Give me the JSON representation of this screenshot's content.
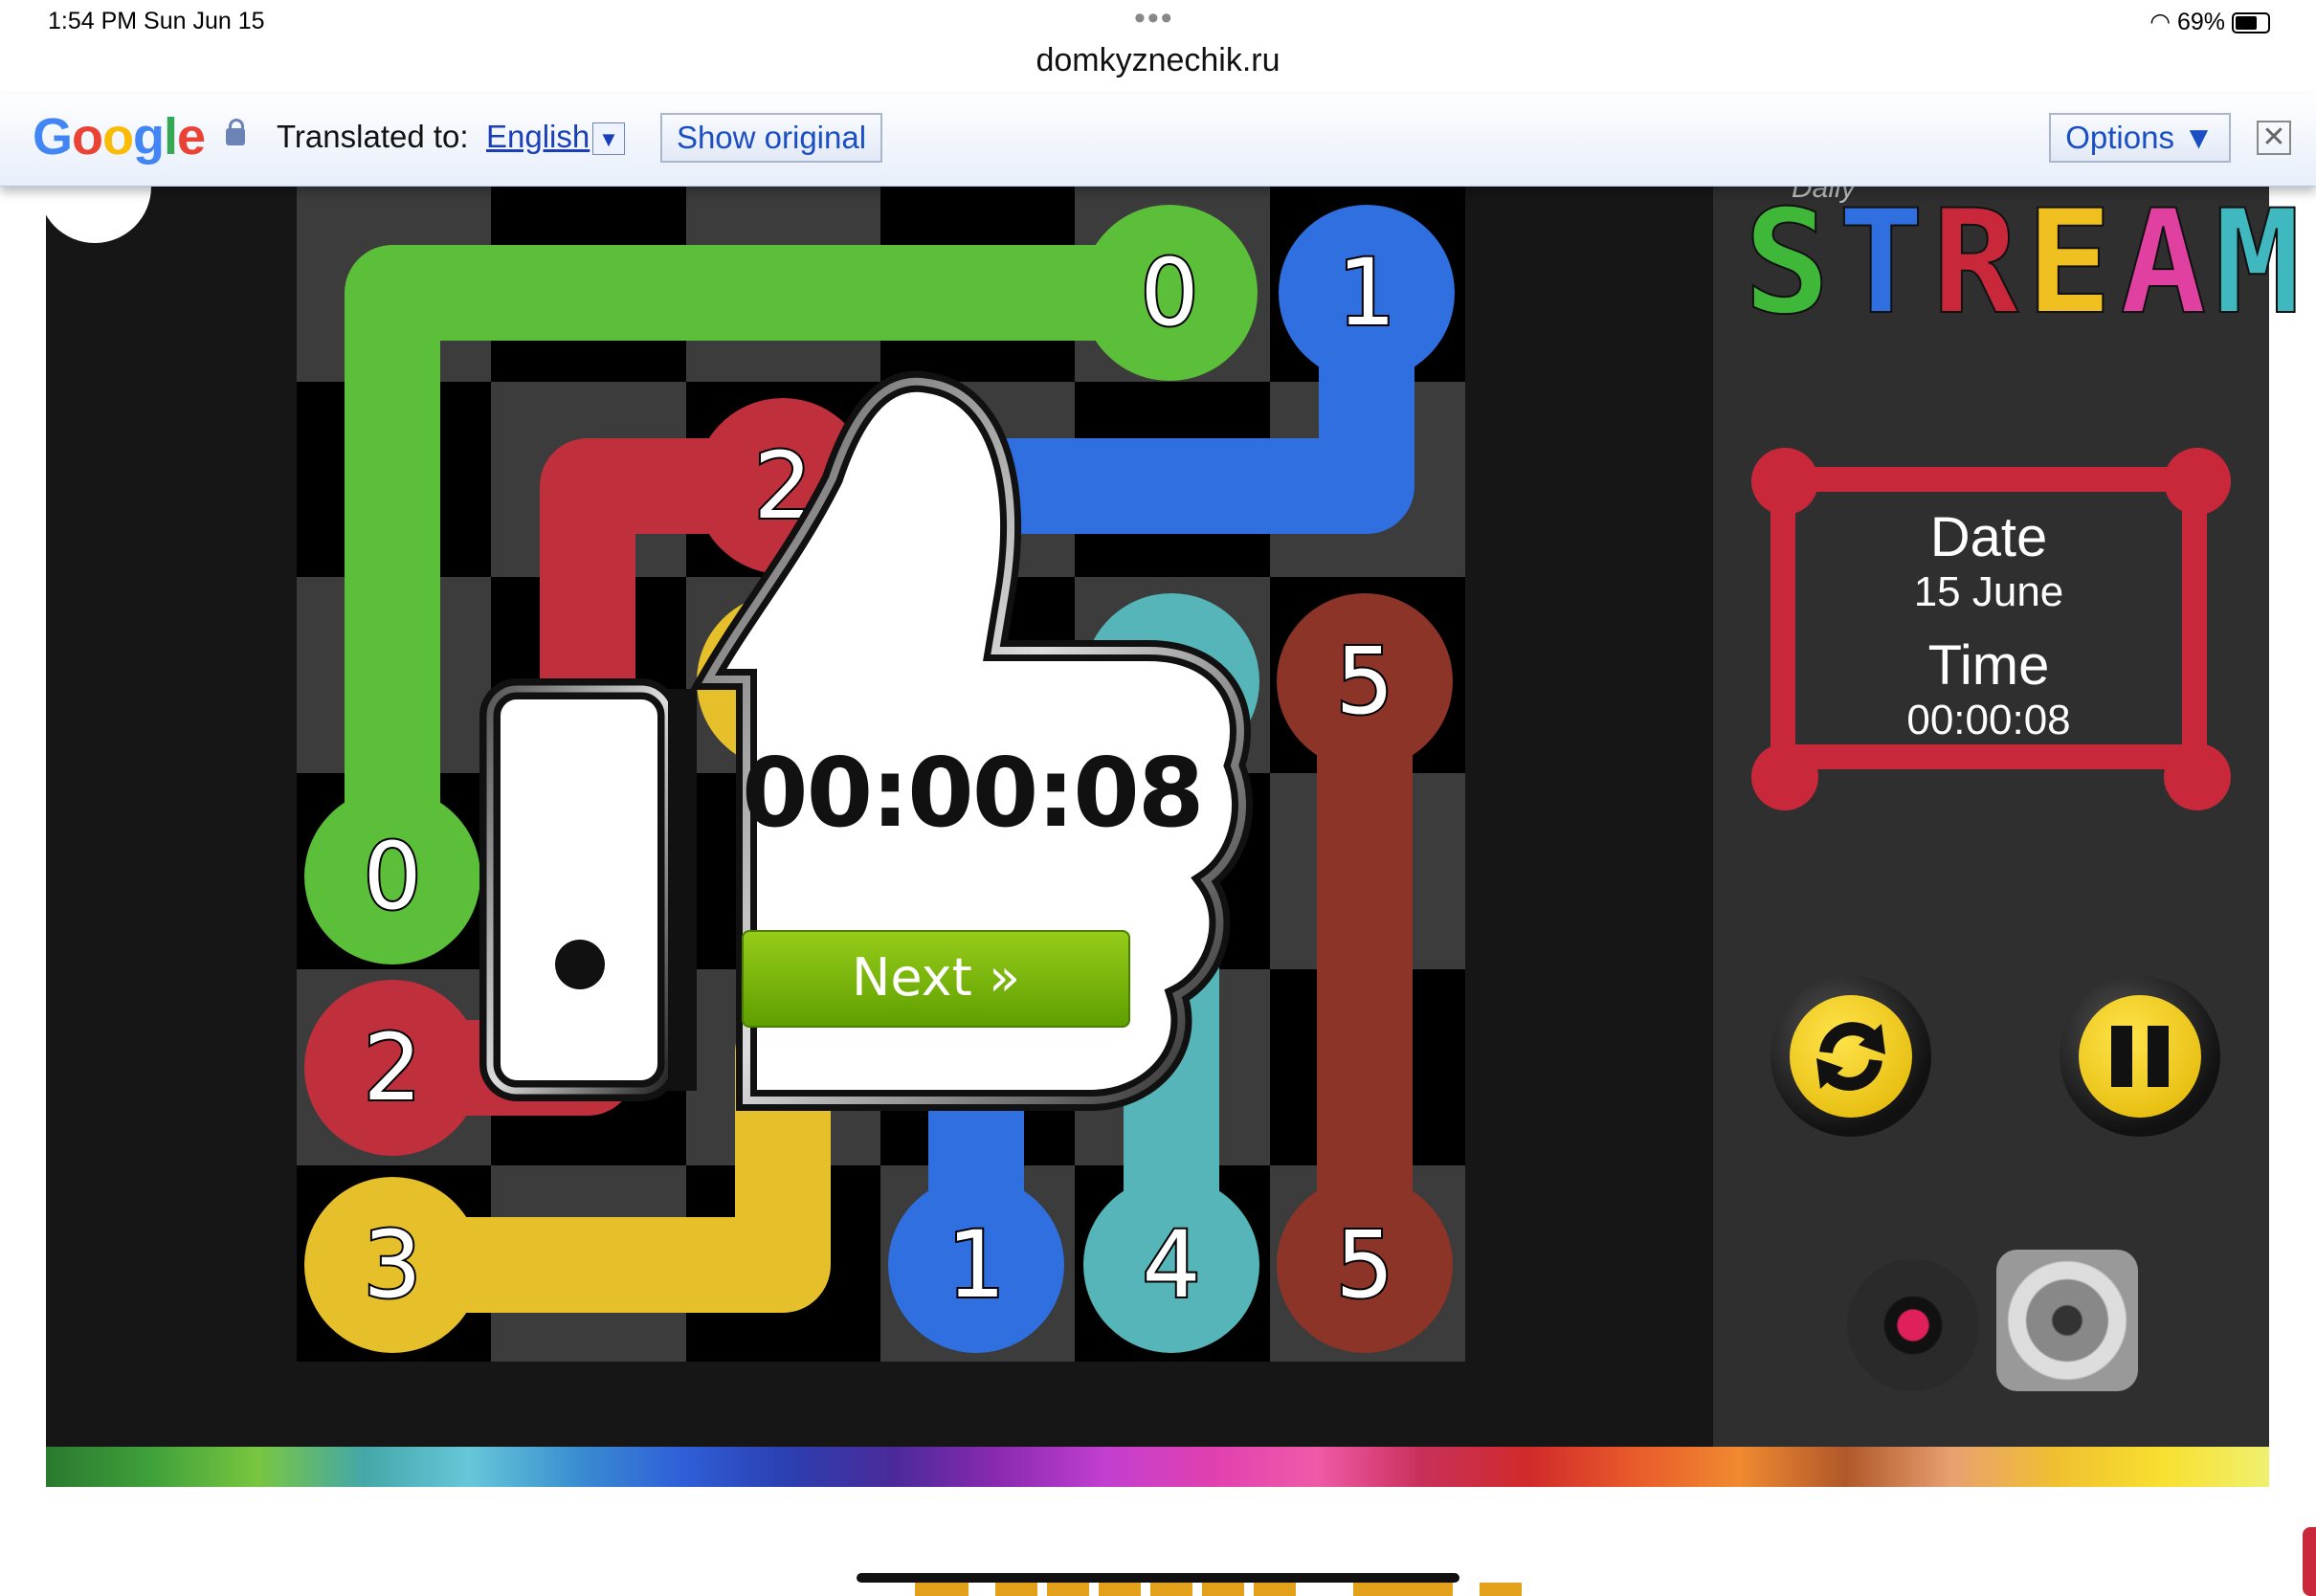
{
  "status_bar": {
    "time": "1:54 PM   Sun Jun 15",
    "dots": "•••",
    "battery": "69%"
  },
  "address": {
    "url": "domkyznechik.ru"
  },
  "translate_bar": {
    "logo": "Google",
    "translated_to": "Translated to:",
    "language": "English",
    "dropdown": "▼",
    "show_original": "Show original",
    "options": "Options ▼",
    "close": "✕"
  },
  "game": {
    "logo_daily": "Daily",
    "logo_letters": [
      "S",
      "T",
      "R",
      "E",
      "A",
      "M"
    ],
    "logo_colors": [
      "#3fb83a",
      "#2f6fe0",
      "#c8283a",
      "#f0c020",
      "#e040a0",
      "#40b8c0"
    ],
    "info": {
      "date_label": "Date",
      "date_value": "15 June",
      "time_label": "Time",
      "time_value": "00:00:08"
    },
    "overlay": {
      "timer": "00:00:08",
      "next": "Next »"
    },
    "dots": [
      {
        "label": "0",
        "color": "#5cbf3a"
      },
      {
        "label": "1",
        "color": "#2f6fe0"
      },
      {
        "label": "2",
        "color": "#c0303c"
      },
      {
        "label": "5",
        "color": "#8c3428"
      },
      {
        "label": "0",
        "color": "#5cbf3a"
      },
      {
        "label": "2",
        "color": "#c0303c"
      },
      {
        "label": "3",
        "color": "#e6c02a"
      },
      {
        "label": "1",
        "color": "#2f6fe0"
      },
      {
        "label": "4",
        "color": "#55b5b8"
      },
      {
        "label": "5",
        "color": "#8c3428"
      }
    ]
  },
  "colors": {
    "frame": "#c8283a",
    "button": "#f0c020"
  }
}
